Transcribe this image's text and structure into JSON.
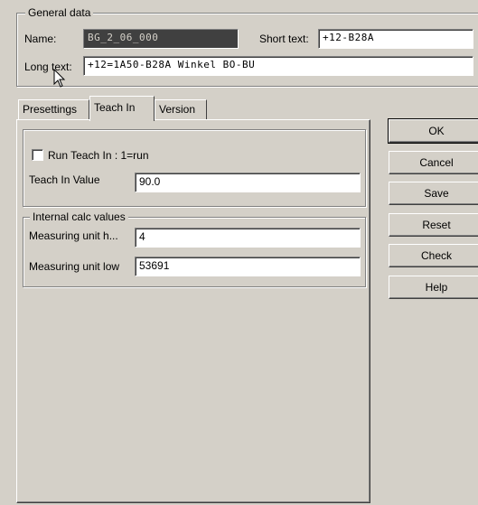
{
  "general_data": {
    "title": "General data",
    "name_label": "Name:",
    "name_value": "BG_2_06_000",
    "short_text_label": "Short text:",
    "short_text_value": "+12-B28A",
    "long_text_label": "Long text:",
    "long_text_value": "+12=1A50-B28A Winkel BO-BU"
  },
  "tabs": [
    {
      "label": "Presettings",
      "active": false
    },
    {
      "label": "Teach In",
      "active": true
    },
    {
      "label": "Version",
      "active": false
    }
  ],
  "teach_in": {
    "run_label": "Run Teach In : 1=run",
    "run_checked": false,
    "value_label": "Teach In Value",
    "value": "90.0"
  },
  "internal_calc": {
    "title": "Internal calc values",
    "high_label": "Measuring unit h...",
    "high_value": "4",
    "low_label": "Measuring unit low",
    "low_value": "53691"
  },
  "buttons": {
    "ok": "OK",
    "cancel": "Cancel",
    "save": "Save",
    "reset": "Reset",
    "check": "Check",
    "help": "Help"
  }
}
